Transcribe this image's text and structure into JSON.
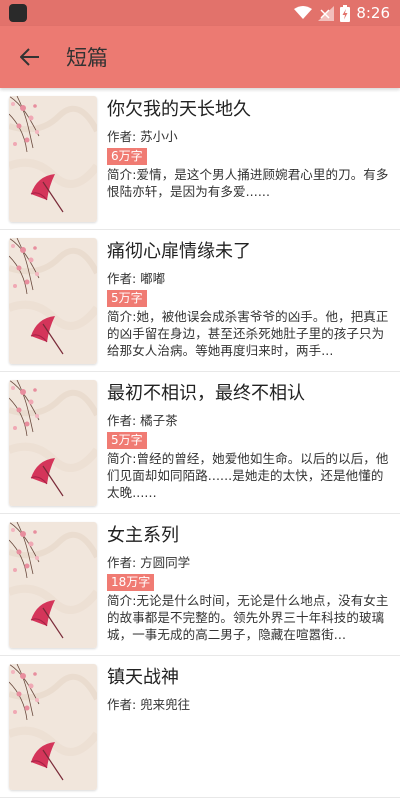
{
  "status_bar": {
    "time": "8:26"
  },
  "app_bar": {
    "title": "短篇"
  },
  "colors": {
    "status_bar": "#e2726b",
    "app_bar": "#ec7a72",
    "badge": "#f07b73"
  },
  "books": [
    {
      "title": "你欠我的天长地久",
      "author": "作者: 苏小小",
      "word_count": "6万字",
      "description": "简介:爱情，是这个男人捅进顾婉君心里的刀。有多恨陆亦轩，是因为有多爱......"
    },
    {
      "title": "痛彻心扉情缘未了",
      "author": "作者: 嘟嘟",
      "word_count": "5万字",
      "description": "简介:她，被他误会成杀害爷爷的凶手。他，把真正的凶手留在身边，甚至还杀死她肚子里的孩子只为给那女人治病。等她再度归来时，两手..."
    },
    {
      "title": "最初不相识，最终不相认",
      "author": "作者: 橘子茶",
      "word_count": "5万字",
      "description": "简介:曾经的曾经，她爱他如生命。以后的以后，他们见面却如同陌路......是她走的太快，还是他懂的太晚......"
    },
    {
      "title": "女主系列",
      "author": "作者: 方圆同学",
      "word_count": "18万字",
      "description": "简介:无论是什么时间，无论是什么地点，没有女主的故事都是不完整的。领先外界三十年科技的玻璃城，一事无成的高二男子，隐藏在喧嚣街..."
    },
    {
      "title": "镇天战神",
      "author": "作者: 兜来兜往",
      "word_count": "",
      "description": ""
    }
  ]
}
